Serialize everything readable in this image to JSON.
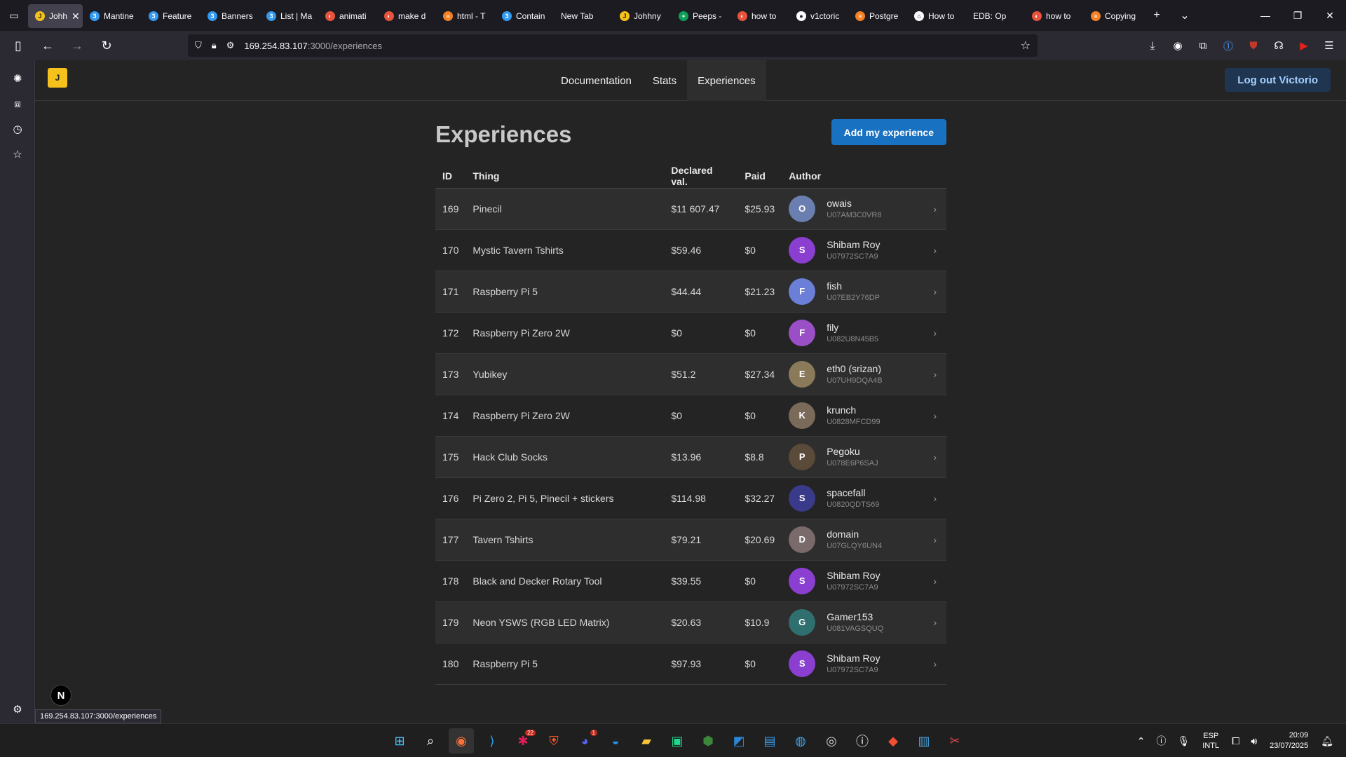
{
  "browser": {
    "tabs": [
      {
        "title": "Johh",
        "color": "#f4c21a",
        "glyph": "J",
        "active": true
      },
      {
        "title": "Mantine",
        "color": "#339af0",
        "glyph": "3"
      },
      {
        "title": "Feature",
        "color": "#339af0",
        "glyph": "3"
      },
      {
        "title": "Banners",
        "color": "#339af0",
        "glyph": "3"
      },
      {
        "title": "List | Ma",
        "color": "#339af0",
        "glyph": "3"
      },
      {
        "title": "animati",
        "color": "#e8533b",
        "glyph": "◐"
      },
      {
        "title": "make d",
        "color": "#e8533b",
        "glyph": "◐"
      },
      {
        "title": "html - T",
        "color": "#f48024",
        "glyph": "≡"
      },
      {
        "title": "Contain",
        "color": "#339af0",
        "glyph": "3"
      },
      {
        "title": "New Tab",
        "color": "",
        "glyph": ""
      },
      {
        "title": "Johhny",
        "color": "#f4c21a",
        "glyph": "J"
      },
      {
        "title": "Peeps -",
        "color": "#0f9d58",
        "glyph": "+"
      },
      {
        "title": "how to",
        "color": "#e8533b",
        "glyph": "◐"
      },
      {
        "title": "v1ctoric",
        "color": "#fbfbfe",
        "glyph": "●"
      },
      {
        "title": "Postgre",
        "color": "#f48024",
        "glyph": "≡"
      },
      {
        "title": "How to",
        "color": "#fbfbfe",
        "glyph": "⌂"
      },
      {
        "title": "EDB: Op",
        "color": "",
        "glyph": ""
      },
      {
        "title": "how to",
        "color": "#e8533b",
        "glyph": "◐"
      },
      {
        "title": "Copying",
        "color": "#f48024",
        "glyph": "≡"
      }
    ],
    "url_host": "169.254.83.107",
    "url_path": ":3000/experiences",
    "status_url": "169.254.83.107:3000/experiences"
  },
  "site": {
    "nav": [
      "Documentation",
      "Stats",
      "Experiences"
    ],
    "logout_label": "Log out Victorio",
    "page_title": "Experiences",
    "add_button": "Add my experience",
    "columns": [
      "ID",
      "Thing",
      "Declared val.",
      "Paid",
      "Author"
    ]
  },
  "rows": [
    {
      "id": "169",
      "thing": "Pinecil",
      "declared": "$11 607.47",
      "paid": "$25.93",
      "author": "owais",
      "uid": "U07AM3C0VR8",
      "avatar_color": "#6a7fb0"
    },
    {
      "id": "170",
      "thing": "Mystic Tavern Tshirts",
      "declared": "$59.46",
      "paid": "$0",
      "author": "Shibam Roy",
      "uid": "U07972SC7A9",
      "avatar_color": "#8a3fd1"
    },
    {
      "id": "171",
      "thing": "Raspberry Pi 5",
      "declared": "$44.44",
      "paid": "$21.23",
      "author": "fish",
      "uid": "U07EB2Y76DP",
      "avatar_color": "#6b7fd8"
    },
    {
      "id": "172",
      "thing": "Raspberry Pi Zero 2W",
      "declared": "$0",
      "paid": "$0",
      "author": "fily",
      "uid": "U082U8N45B5",
      "avatar_color": "#9b4fc7"
    },
    {
      "id": "173",
      "thing": "Yubikey",
      "declared": "$51.2",
      "paid": "$27.34",
      "author": "eth0 (srizan)",
      "uid": "U07UH9DQA4B",
      "avatar_color": "#8a7a5a"
    },
    {
      "id": "174",
      "thing": "Raspberry Pi Zero 2W",
      "declared": "$0",
      "paid": "$0",
      "author": "krunch",
      "uid": "U0828MFCD99",
      "avatar_color": "#7a6a5a"
    },
    {
      "id": "175",
      "thing": "Hack Club Socks",
      "declared": "$13.96",
      "paid": "$8.8",
      "author": "Pegoku",
      "uid": "U078E6P6SAJ",
      "avatar_color": "#5a4a3a"
    },
    {
      "id": "176",
      "thing": "Pi Zero 2, Pi 5, Pinecil + stickers",
      "declared": "$114.98",
      "paid": "$32.27",
      "author": "spacefall",
      "uid": "U0820QDTS69",
      "avatar_color": "#3a3a8a"
    },
    {
      "id": "177",
      "thing": "Tavern Tshirts",
      "declared": "$79.21",
      "paid": "$20.69",
      "author": "domain",
      "uid": "U07GLQY6UN4",
      "avatar_color": "#7a6a6a"
    },
    {
      "id": "178",
      "thing": "Black and Decker Rotary Tool",
      "declared": "$39.55",
      "paid": "$0",
      "author": "Shibam Roy",
      "uid": "U07972SC7A9",
      "avatar_color": "#8a3fd1"
    },
    {
      "id": "179",
      "thing": "Neon YSWS (RGB LED Matrix)",
      "declared": "$20.63",
      "paid": "$10.9",
      "author": "Gamer153",
      "uid": "U081VAGSQUQ",
      "avatar_color": "#2f6f6f"
    },
    {
      "id": "180",
      "thing": "Raspberry Pi 5",
      "declared": "$97.93",
      "paid": "$0",
      "author": "Shibam Roy",
      "uid": "U07972SC7A9",
      "avatar_color": "#8a3fd1"
    }
  ],
  "taskbar": {
    "discord_badge": "1",
    "mail_badge": "22",
    "lang_top": "ESP",
    "lang_bottom": "INTL",
    "time": "20:09",
    "date": "23/07/2025"
  }
}
